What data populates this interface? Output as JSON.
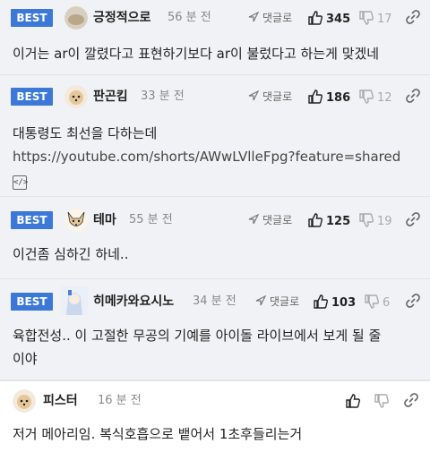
{
  "comments": [
    {
      "badge": "BEST",
      "nickname": "긍정적으로",
      "time": "56 분 전",
      "reply_label": "댓글로",
      "likes": "345",
      "dislikes": "17",
      "text_lines": [
        "이거는 ar이 깔렸다고 표현하기보다 ar이 불렀다고 하는게 맞겠네"
      ]
    },
    {
      "badge": "BEST",
      "nickname": "판곤킴",
      "time": "33 분 전",
      "reply_label": "댓글로",
      "likes": "186",
      "dislikes": "12",
      "text_lines": [
        "대통령도 최선을 다하는데"
      ],
      "link": "https://youtube.com/shorts/AWwLVlleFpg?feature=shared",
      "embed_icon": "</>"
    },
    {
      "badge": "BEST",
      "nickname": "테마",
      "time": "55 분 전",
      "reply_label": "댓글로",
      "likes": "125",
      "dislikes": "19",
      "text_lines": [
        "이건좀 심하긴 하네.."
      ]
    },
    {
      "badge": "BEST",
      "nickname": "히메카와요시노",
      "time": "34 분 전",
      "reply_label": "댓글로",
      "likes": "103",
      "dislikes": "6",
      "text_lines": [
        "육합전성.. 이 고절한 무공의 기예를 아이돌 라이브에서 보게 될 줄",
        "이야"
      ]
    },
    {
      "nickname": "피스터",
      "time": "16 분 전",
      "text_lines": [
        "저거 메아리임. 복식호흡으로 뱉어서 1초후들리는거"
      ]
    }
  ],
  "colors": {
    "best_badge": "#3b78d8",
    "best_bg": "#f1f2f5"
  },
  "icons": [
    "thumbs-up-icon",
    "thumbs-down-icon",
    "reply-arrow-icon",
    "share-link-icon",
    "code-embed-icon"
  ]
}
